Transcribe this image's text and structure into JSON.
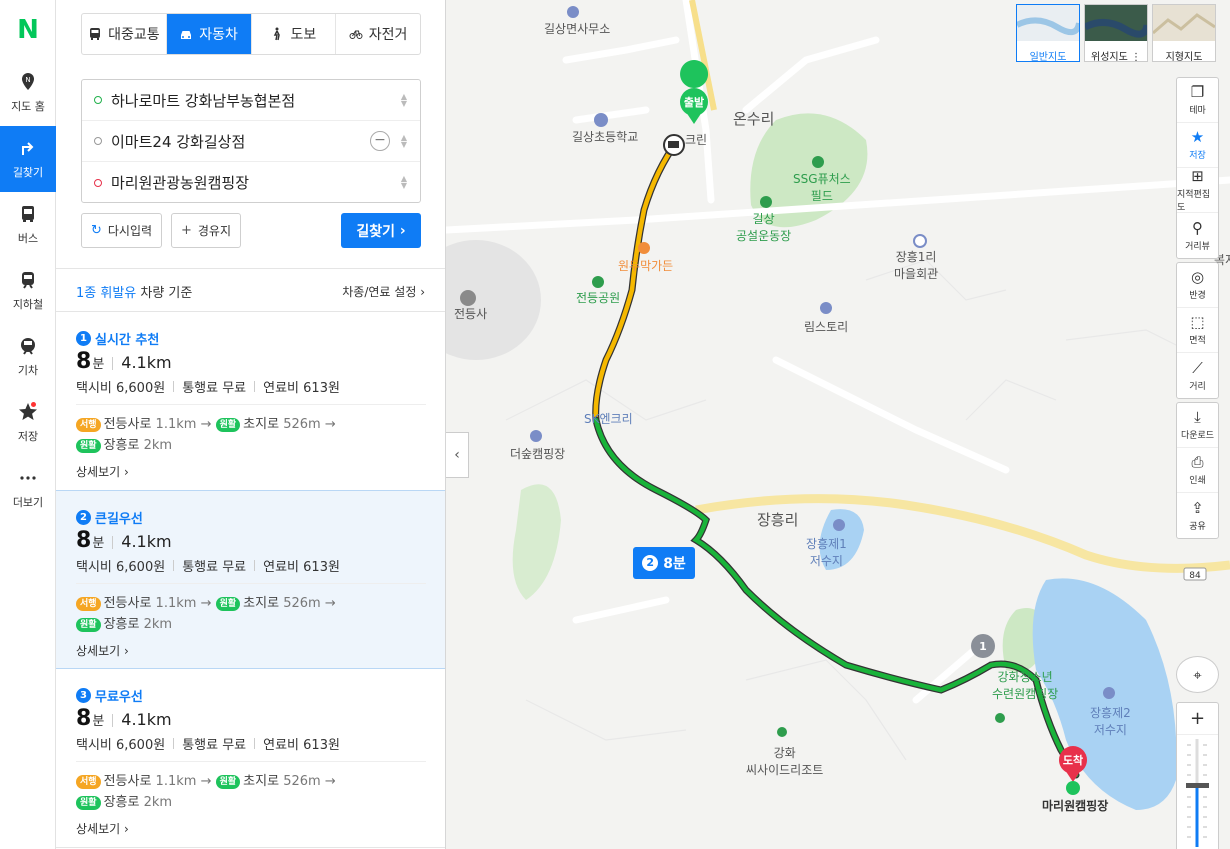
{
  "brand": {
    "logo": "N"
  },
  "rail": [
    {
      "name": "map-home",
      "label": "지도 홈"
    },
    {
      "name": "directions",
      "label": "길찾기"
    },
    {
      "name": "bus",
      "label": "버스"
    },
    {
      "name": "subway",
      "label": "지하철"
    },
    {
      "name": "train",
      "label": "기차"
    },
    {
      "name": "saved",
      "label": "저장"
    },
    {
      "name": "more",
      "label": "더보기"
    }
  ],
  "modes": [
    "대중교통",
    "자동차",
    "도보",
    "자전거"
  ],
  "stops": {
    "start": "하나로마트 강화남부농협본점",
    "waypoint": "이마트24 강화길상점",
    "end": "마리원관광농원캠핑장"
  },
  "buttons": {
    "reset": "다시입력",
    "add_waypoint": "경유지",
    "find": "길찾기"
  },
  "fuel": {
    "prefix": "1종 휘발유",
    "suffix": " 차량 기준",
    "setting": "차종/연료 설정"
  },
  "routes": [
    {
      "num": "1",
      "title": "실시간 추천",
      "time": "8",
      "time_unit": "분",
      "dist": "4.1km",
      "taxi": "택시비 6,600원",
      "toll": "통행료 무료",
      "fuel": "연료비 613원",
      "leg1_tag": "서행",
      "leg1": "전등사로",
      "leg1_dist": "1.1km",
      "leg2_tag": "원활",
      "leg2": "초지로",
      "leg2_dist": "526m",
      "leg3_tag": "원활",
      "leg3": "장흥로",
      "leg3_dist": "2km",
      "detail": "상세보기"
    },
    {
      "num": "2",
      "title": "큰길우선",
      "time": "8",
      "time_unit": "분",
      "dist": "4.1km",
      "taxi": "택시비 6,600원",
      "toll": "통행료 무료",
      "fuel": "연료비 613원",
      "leg1_tag": "서행",
      "leg1": "전등사로",
      "leg1_dist": "1.1km",
      "leg2_tag": "원활",
      "leg2": "초지로",
      "leg2_dist": "526m",
      "leg3_tag": "원활",
      "leg3": "장흥로",
      "leg3_dist": "2km",
      "detail": "상세보기"
    },
    {
      "num": "3",
      "title": "무료우선",
      "time": "8",
      "time_unit": "분",
      "dist": "4.1km",
      "taxi": "택시비 6,600원",
      "toll": "통행료 무료",
      "fuel": "연료비 613원",
      "leg1_tag": "서행",
      "leg1": "전등사로",
      "leg1_dist": "1.1km",
      "leg2_tag": "원활",
      "leg2": "초지로",
      "leg2_dist": "526m",
      "leg3_tag": "원활",
      "leg3": "장흥로",
      "leg3_dist": "2km",
      "detail": "상세보기"
    }
  ],
  "map": {
    "maptypes": [
      "일반지도",
      "위성지도",
      "지형지도"
    ],
    "tools": [
      "테마",
      "저장",
      "지적편집도",
      "거리뷰",
      "반경",
      "면적",
      "거리",
      "다운로드",
      "인쇄",
      "공유"
    ],
    "route_badge": {
      "num": "2",
      "time": "8분"
    },
    "markers": {
      "start": "출발",
      "end": "도착",
      "waypoint": "1"
    },
    "labels": {
      "gilsang_office": "길상면사무소",
      "gilsang_school": "길상초등학교",
      "onsu": "온수리",
      "ssg_field": "SSG퓨처스\n필드",
      "gilsang_stadium": "길상\n공설운동장",
      "janghung1": "장흥1리\n마을회관",
      "jeondeung_park": "전등공원",
      "jeondeungsa": "전등사",
      "garden": "원두막가든",
      "rimstory": "림스토리",
      "sk": "SK엔크리",
      "deosup": "더숲캠핑장",
      "janghungri": "장흥리",
      "reservoir1": "장흥제1\n저수지",
      "reservoir2": "장흥제2\n저수지",
      "youth_camp": "강화청소년\n수련원캠핑장",
      "seaside": "강화\n씨사이드리조트",
      "mariwon": "마리원캠핑장",
      "route84": "84",
      "top_station": "크린",
      "right_edge": "복지회관"
    }
  },
  "colors": {
    "accent": "#0f7cf5",
    "brand": "#03c75a",
    "route_slow": "#f5b800",
    "route_smooth": "#19b33a",
    "end_marker": "#e8314b",
    "water": "#a9d2f3",
    "park": "#cde8c4"
  }
}
